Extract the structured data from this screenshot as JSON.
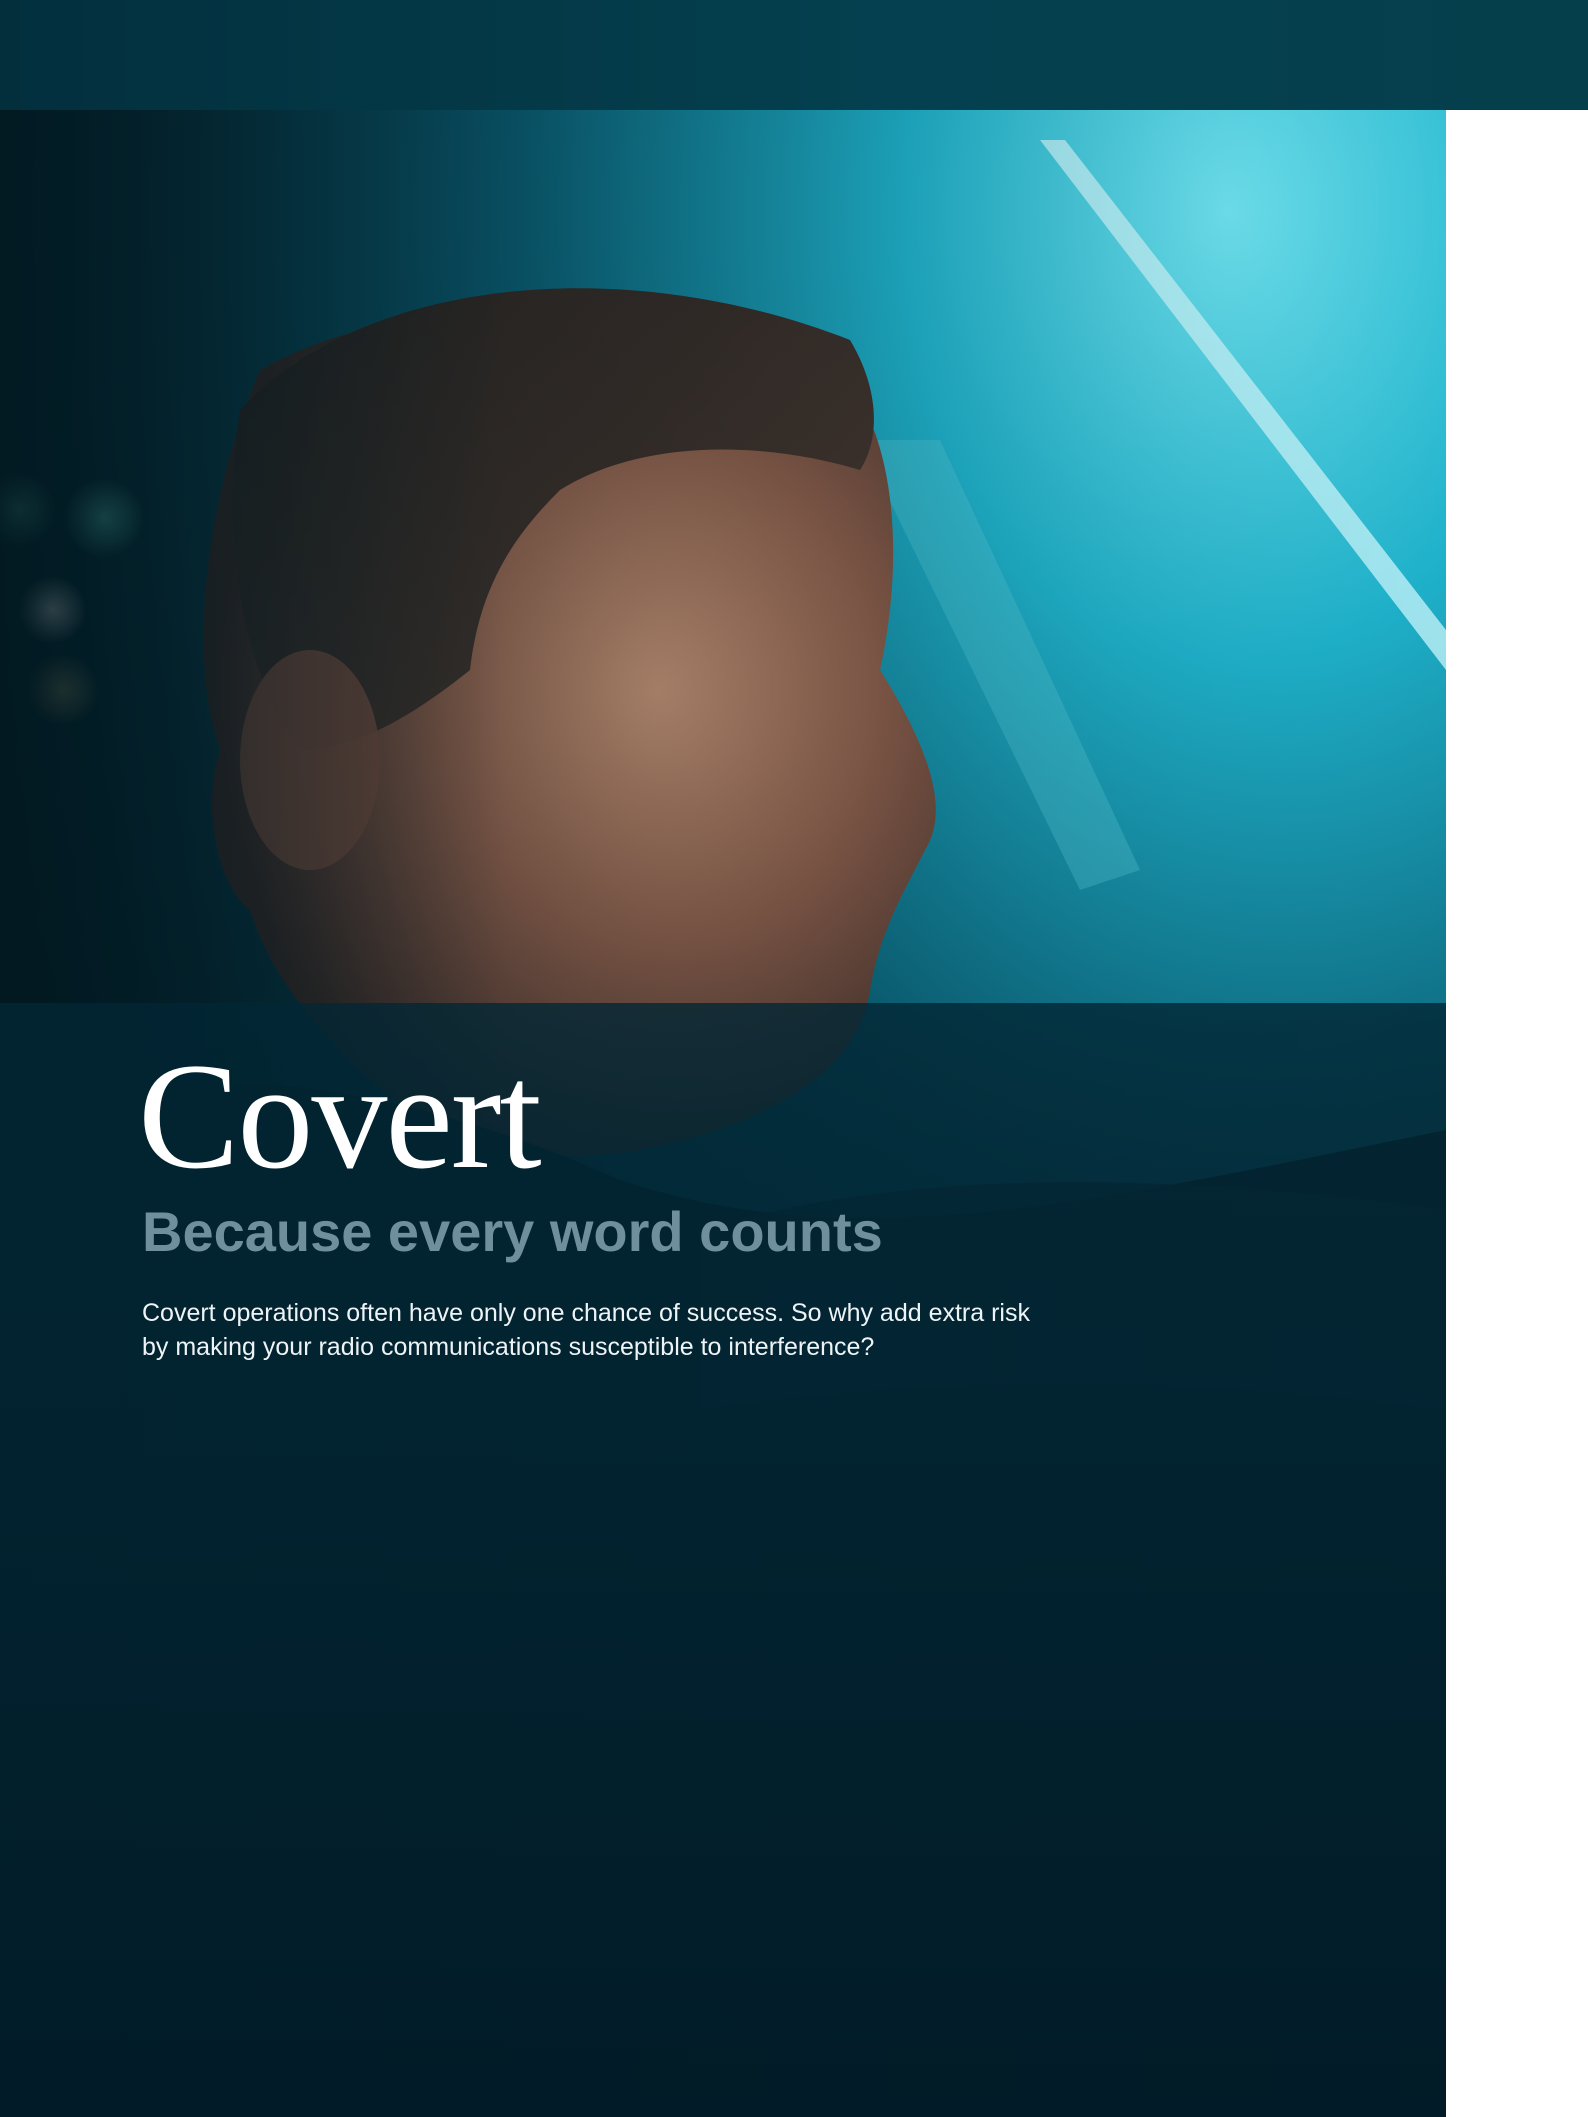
{
  "headline": "Covert",
  "subheadline": "Because every word counts",
  "body": {
    "line1": "Covert operations often have only one chance of success. So why add extra risk",
    "line2": "by making your radio communications susceptible to interference?"
  },
  "colors": {
    "band": "#04404f",
    "panel": "#022634",
    "headline": "#ffffff",
    "subheadline": "#6f8f9c",
    "body": "#eef4f6",
    "accent_light": "#2fc7dc"
  }
}
